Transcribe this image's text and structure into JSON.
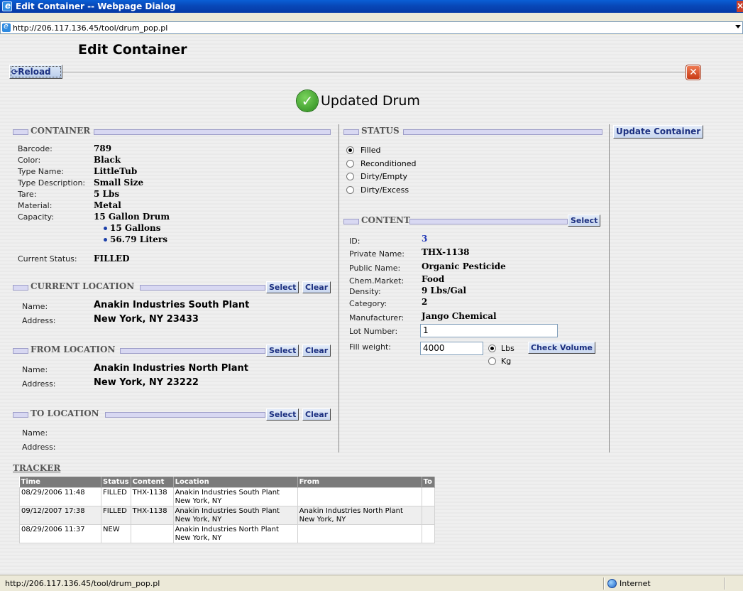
{
  "window": {
    "title": "Edit Container -- Webpage Dialog",
    "address": "http://206.117.136.45/tool/drum_pop.pl"
  },
  "page": {
    "title": "Edit Container",
    "reload_label": "Reload",
    "status_message": "Updated Drum",
    "update_button": "Update Container"
  },
  "container": {
    "heading": "CONTAINER",
    "fields": [
      {
        "label": "Barcode:",
        "value": "789"
      },
      {
        "label": "Color:",
        "value": "Black"
      },
      {
        "label": "Type Name:",
        "value": "LittleTub"
      },
      {
        "label": "Type Description:",
        "value": "Small Size"
      },
      {
        "label": "Tare:",
        "value": "5 Lbs"
      },
      {
        "label": "Material:",
        "value": "Metal"
      },
      {
        "label": "Capacity:",
        "value": "15 Gallon Drum"
      }
    ],
    "capacity_bullets": [
      "15 Gallons",
      "56.79 Liters"
    ],
    "current_status_label": "Current Status:",
    "current_status_value": "FILLED"
  },
  "current_location": {
    "heading": "CURRENT LOCATION",
    "select": "Select",
    "clear": "Clear",
    "name_label": "Name:",
    "name": "Anakin Industries South Plant",
    "address_label": "Address:",
    "address": "New York, NY  23433"
  },
  "from_location": {
    "heading": "FROM LOCATION",
    "select": "Select",
    "clear": "Clear",
    "name_label": "Name:",
    "name": "Anakin Industries North Plant",
    "address_label": "Address:",
    "address": "New York, NY  23222"
  },
  "to_location": {
    "heading": "TO LOCATION",
    "select": "Select",
    "clear": "Clear",
    "name_label": "Name:",
    "address_label": "Address:"
  },
  "status": {
    "heading": "STATUS",
    "options": [
      "Filled",
      "Reconditioned",
      "Dirty/Empty",
      "Dirty/Excess"
    ],
    "selected": "Filled"
  },
  "content": {
    "heading": "CONTENT",
    "select": "Select",
    "id_label": "ID:",
    "id": "3",
    "private_name_label": "Private Name:",
    "private_name": "THX-1138",
    "public_name_label": "Public Name:",
    "public_name": "Organic Pesticide",
    "chem_market_label": "Chem.Market:",
    "chem_market": "Food",
    "density_label": "Density:",
    "density": "9 Lbs/Gal",
    "category_label": "Category:",
    "category": "2",
    "manufacturer_label": "Manufacturer:",
    "manufacturer": "Jango Chemical",
    "lot_label": "Lot Number:",
    "lot_value": "1",
    "fill_label": "Fill weight:",
    "fill_value": "4000",
    "unit_lbs": "Lbs",
    "unit_kg": "Kg",
    "unit_selected": "Lbs",
    "check_volume": "Check Volume"
  },
  "tracker": {
    "title": "TRACKER",
    "columns": [
      "Time",
      "Status",
      "Content",
      "Location",
      "From",
      "To"
    ],
    "rows": [
      {
        "time": "08/29/2006 11:48",
        "status": "FILLED",
        "content": "THX-1138",
        "location": "Anakin Industries South Plant",
        "location_city": "New York, NY",
        "from": "",
        "from_city": "",
        "to": ""
      },
      {
        "time": "09/12/2007 17:38",
        "status": "FILLED",
        "content": "THX-1138",
        "location": "Anakin Industries South Plant",
        "location_city": "New York, NY",
        "from": "Anakin Industries North Plant",
        "from_city": "New York, NY",
        "to": ""
      },
      {
        "time": "08/29/2006 11:37",
        "status": "NEW",
        "content": "",
        "location": "Anakin Industries North Plant",
        "location_city": "New York, NY",
        "from": "",
        "from_city": "",
        "to": ""
      }
    ]
  },
  "statusbar": {
    "url": "http://206.117.136.45/tool/drum_pop.pl",
    "zone": "Internet"
  },
  "icons": {
    "reload": "reload-icon",
    "close": "close-icon",
    "check": "check-icon",
    "globe": "globe-icon"
  },
  "colors": {
    "titlebar": "#0848b8",
    "button_text": "#1b2f80",
    "close": "#d8482a",
    "success": "#3aa12a",
    "header_bar": "#d8d8f2"
  }
}
